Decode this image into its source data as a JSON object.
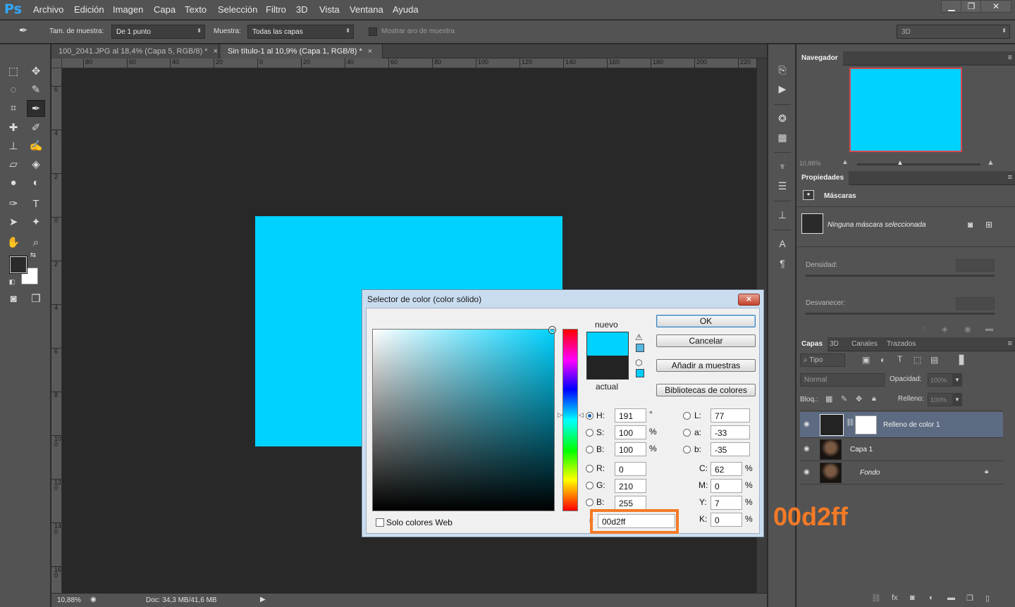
{
  "app": {
    "logo": "Ps",
    "menu": [
      "Archivo",
      "Edición",
      "Imagen",
      "Capa",
      "Texto",
      "Selección",
      "Filtro",
      "3D",
      "Vista",
      "Ventana",
      "Ayuda"
    ],
    "window_buttons": [
      "▁",
      "❐",
      "✕"
    ]
  },
  "options": {
    "sample_size_label": "Tam. de muestra:",
    "sample_size_value": "De 1 punto",
    "sample_label": "Muestra:",
    "sample_value": "Todas las capas",
    "show_ring_label": "Mostrar aro de muestra",
    "workspace_value": "3D"
  },
  "tabs": [
    {
      "label": "100_2041.JPG al 18,4% (Capa 5, RGB/8) *",
      "close": "×",
      "active": false
    },
    {
      "label": "Sin título-1 al 10,9% (Capa 1, RGB/8) *",
      "close": "×",
      "active": true
    }
  ],
  "rulers": {
    "top": [
      "80",
      "60",
      "40",
      "20",
      "0",
      "20",
      "40",
      "60",
      "80",
      "100",
      "120",
      "140",
      "160",
      "180",
      "200",
      "220"
    ],
    "left": [
      "6",
      "4",
      "2",
      "0",
      "2",
      "4",
      "6",
      "8",
      "100",
      "120",
      "140",
      "160"
    ]
  },
  "canvas": {
    "color": "#00d2ff"
  },
  "status": {
    "zoom": "10,88%",
    "doc": "Doc: 34,3 MB/41,6 MB"
  },
  "navigator": {
    "title": "Navegador",
    "zoom": "10,88%",
    "thumb_color": "#00d2ff"
  },
  "properties": {
    "title": "Propiedades",
    "section": "Máscaras",
    "no_mask": "Ninguna máscara seleccionada",
    "density": "Densidad:",
    "feather": "Desvanecer:"
  },
  "layers_panel": {
    "tabs": [
      "Capas",
      "3D",
      "Canales",
      "Trazados"
    ],
    "filter_label": "Tipo",
    "blend_mode": "Normal",
    "opacity_label": "Opacidad:",
    "opacity_value": "100%",
    "lock_label": "Bloq.:",
    "fill_label": "Relleno:",
    "fill_value": "100%",
    "layers": [
      {
        "name": "Relleno de color 1",
        "selected": true
      },
      {
        "name": "Capa 1",
        "selected": false
      },
      {
        "name": "Fondo",
        "selected": false,
        "locked": true
      }
    ]
  },
  "dialog": {
    "title": "Selector de color (color sólido)",
    "close": "✕",
    "new_label": "nuevo",
    "current_label": "actual",
    "new_color": "#00d2ff",
    "current_color": "#232323",
    "buttons": {
      "ok": "OK",
      "cancel": "Cancelar",
      "add_swatches": "Añadir a muestras",
      "libraries": "Bibliotecas de colores"
    },
    "hsb": {
      "h_label": "H:",
      "h": "191",
      "h_unit": "°",
      "s_label": "S:",
      "s": "100",
      "s_unit": "%",
      "b_label": "B:",
      "b": "100",
      "b_unit": "%"
    },
    "rgb": {
      "r_label": "R:",
      "r": "0",
      "g_label": "G:",
      "g": "210",
      "b_label": "B:",
      "b": "255"
    },
    "lab": {
      "l_label": "L:",
      "l": "77",
      "a_label": "a:",
      "a": "-33",
      "b_label": "b:",
      "b": "-35"
    },
    "cmyk": {
      "c_label": "C:",
      "c": "62",
      "m_label": "M:",
      "m": "0",
      "y_label": "Y:",
      "y": "7",
      "k_label": "K:",
      "k": "0",
      "unit": "%"
    },
    "hex_prefix": "#",
    "hex": "00d2ff",
    "web_only_label": "Solo colores Web"
  },
  "annotation": "00d2ff",
  "accent": "#f47a26"
}
